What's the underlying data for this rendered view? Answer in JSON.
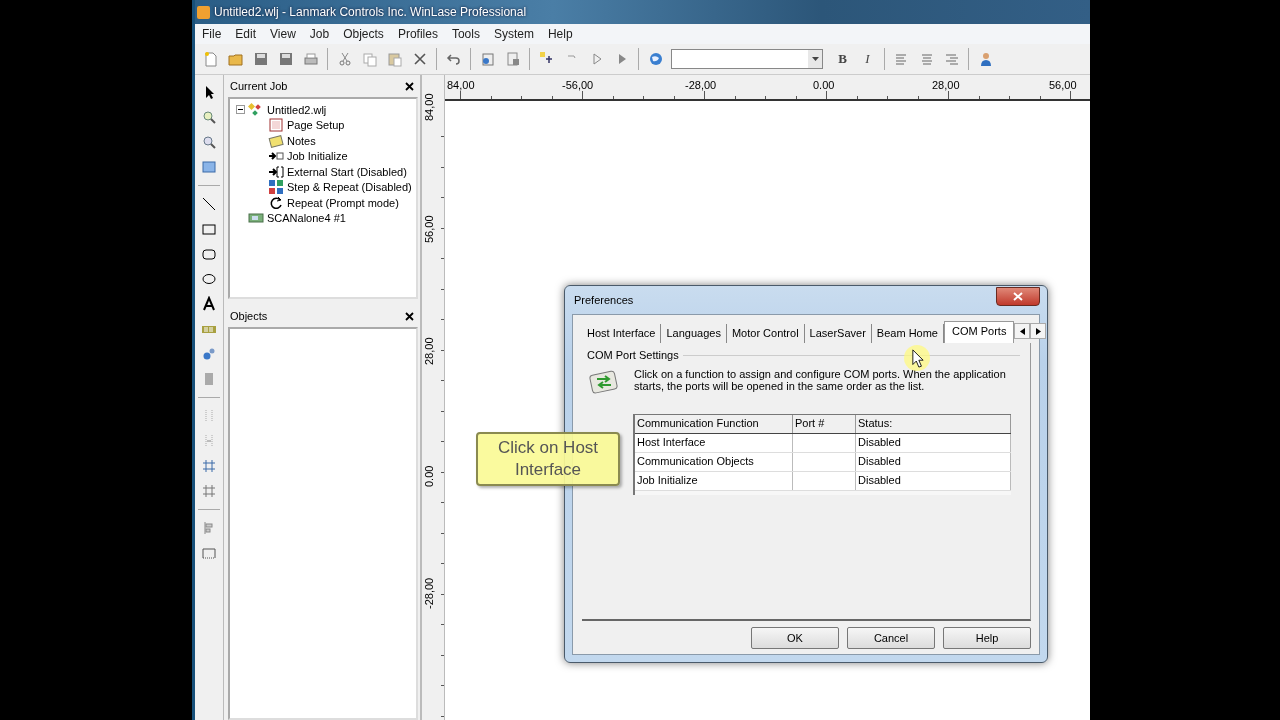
{
  "window": {
    "title": "Untitled2.wlj - Lanmark Controls Inc. WinLase Professional"
  },
  "menu": [
    "File",
    "Edit",
    "View",
    "Job",
    "Objects",
    "Profiles",
    "Tools",
    "System",
    "Help"
  ],
  "toolbar": {
    "font_buttons": [
      "B",
      "I"
    ]
  },
  "current_job": {
    "title": "Current Job",
    "tree": [
      {
        "label": "Untitled2.wlj",
        "expanded": true,
        "children": [
          {
            "label": "Page Setup"
          },
          {
            "label": "Notes"
          },
          {
            "label": "Job Initialize"
          },
          {
            "label": "External Start (Disabled)"
          },
          {
            "label": "Step & Repeat (Disabled)"
          },
          {
            "label": "Repeat (Prompt mode)"
          }
        ]
      },
      {
        "label": "SCANalone4 #1"
      }
    ]
  },
  "objects": {
    "title": "Objects"
  },
  "rulers": {
    "horizontal": [
      "84,00",
      "-56,00",
      "-28,00",
      "0.00",
      "28,00",
      "56,00"
    ],
    "vertical": [
      "84,00",
      "56,00",
      "28,00",
      "0.00",
      "-28,00"
    ]
  },
  "dialog": {
    "title": "Preferences",
    "tabs": [
      {
        "label": "Host Interface",
        "selected": false
      },
      {
        "label": "Languages",
        "selected": false
      },
      {
        "label": "Motor Control",
        "selected": false
      },
      {
        "label": "LaserSaver",
        "selected": false
      },
      {
        "label": "Beam Home",
        "selected": false
      },
      {
        "label": "COM Ports",
        "selected": true
      }
    ],
    "group": "COM Port Settings",
    "description": "Click on a function to assign and configure COM ports. When the application starts, the ports will be opened in the same order as the list.",
    "table": {
      "columns": [
        "Communication Function",
        "Port #",
        "Status:"
      ],
      "rows": [
        {
          "cells": [
            "Host Interface",
            "",
            "Disabled"
          ],
          "selected": false
        },
        {
          "cells": [
            "Communication Objects",
            "",
            "Disabled"
          ],
          "selected": false
        },
        {
          "cells": [
            "Job Initialize",
            "",
            "Disabled"
          ],
          "selected": false
        }
      ]
    },
    "buttons": [
      "OK",
      "Cancel",
      "Help"
    ]
  },
  "callout": {
    "text": "Click on Host Interface"
  }
}
